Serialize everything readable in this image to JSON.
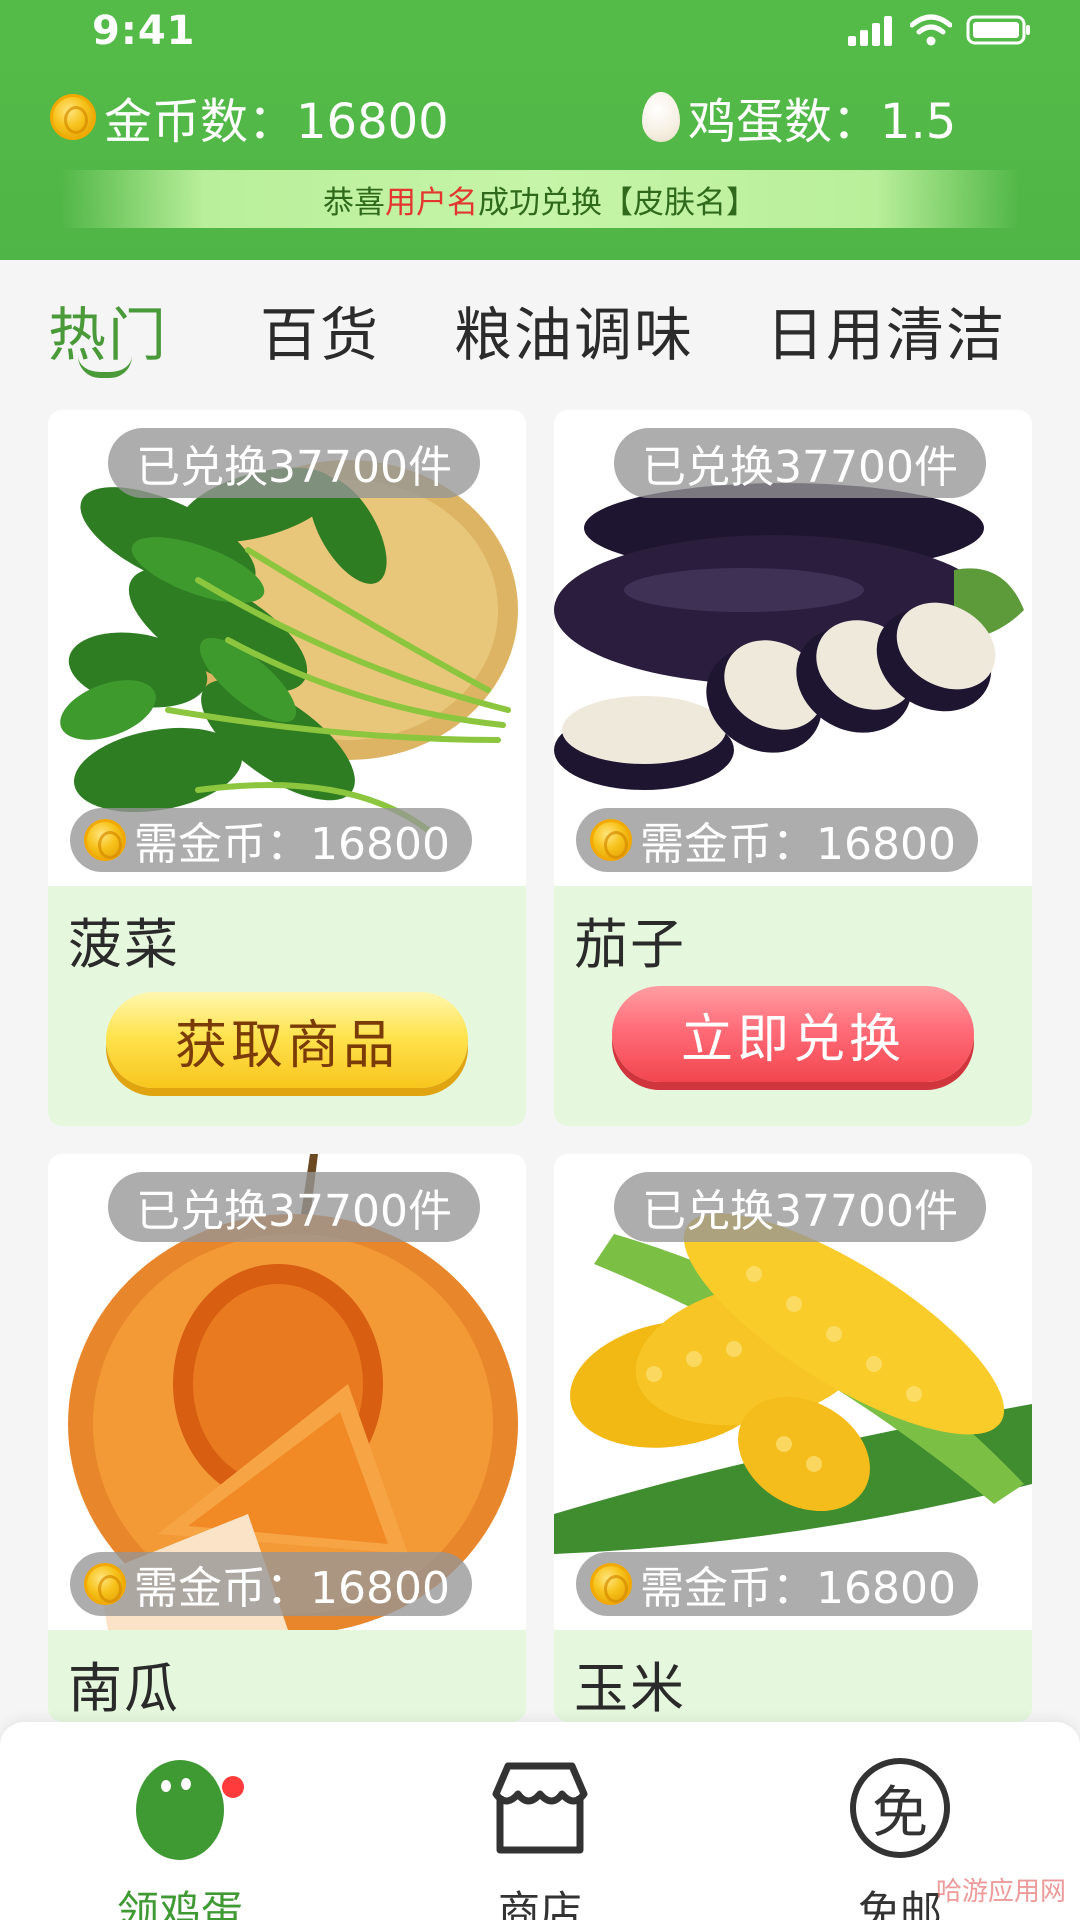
{
  "status_bar": {
    "time": "9:41"
  },
  "header": {
    "coins_label": "金币数：16800",
    "eggs_label": "鸡蛋数：1.5",
    "banner": {
      "prefix": "恭喜",
      "user": "用户名",
      "middle": "成功兑换【皮肤名】"
    }
  },
  "tabs": [
    {
      "label": "热门"
    },
    {
      "label": "百货"
    },
    {
      "label": "粮油调味"
    },
    {
      "label": "日用清洁"
    }
  ],
  "products": [
    {
      "name": "菠菜",
      "exchanged": "已兑换37700件",
      "price": "需金币：16800",
      "button": "获取商品"
    },
    {
      "name": "茄子",
      "exchanged": "已兑换37700件",
      "price": "需金币：16800",
      "button": "立即兑换"
    },
    {
      "name": "南瓜",
      "exchanged": "已兑换37700件",
      "price": "需金币：16800"
    },
    {
      "name": "玉米",
      "exchanged": "已兑换37700件",
      "price": "需金币：16800"
    }
  ],
  "bottom_nav": [
    {
      "label": "领鸡蛋",
      "icon": "egg-icon"
    },
    {
      "label": "商店",
      "icon": "shop-icon"
    },
    {
      "label": "免邮",
      "icon": "free-shipping-icon",
      "icon_text": "免"
    }
  ],
  "watermark": "哈游应用网",
  "colors": {
    "header_green": "#55bb48",
    "accent_green": "#4a9a3a",
    "card_info_bg": "#e5f8de",
    "highlight_red": "#e3362e"
  }
}
